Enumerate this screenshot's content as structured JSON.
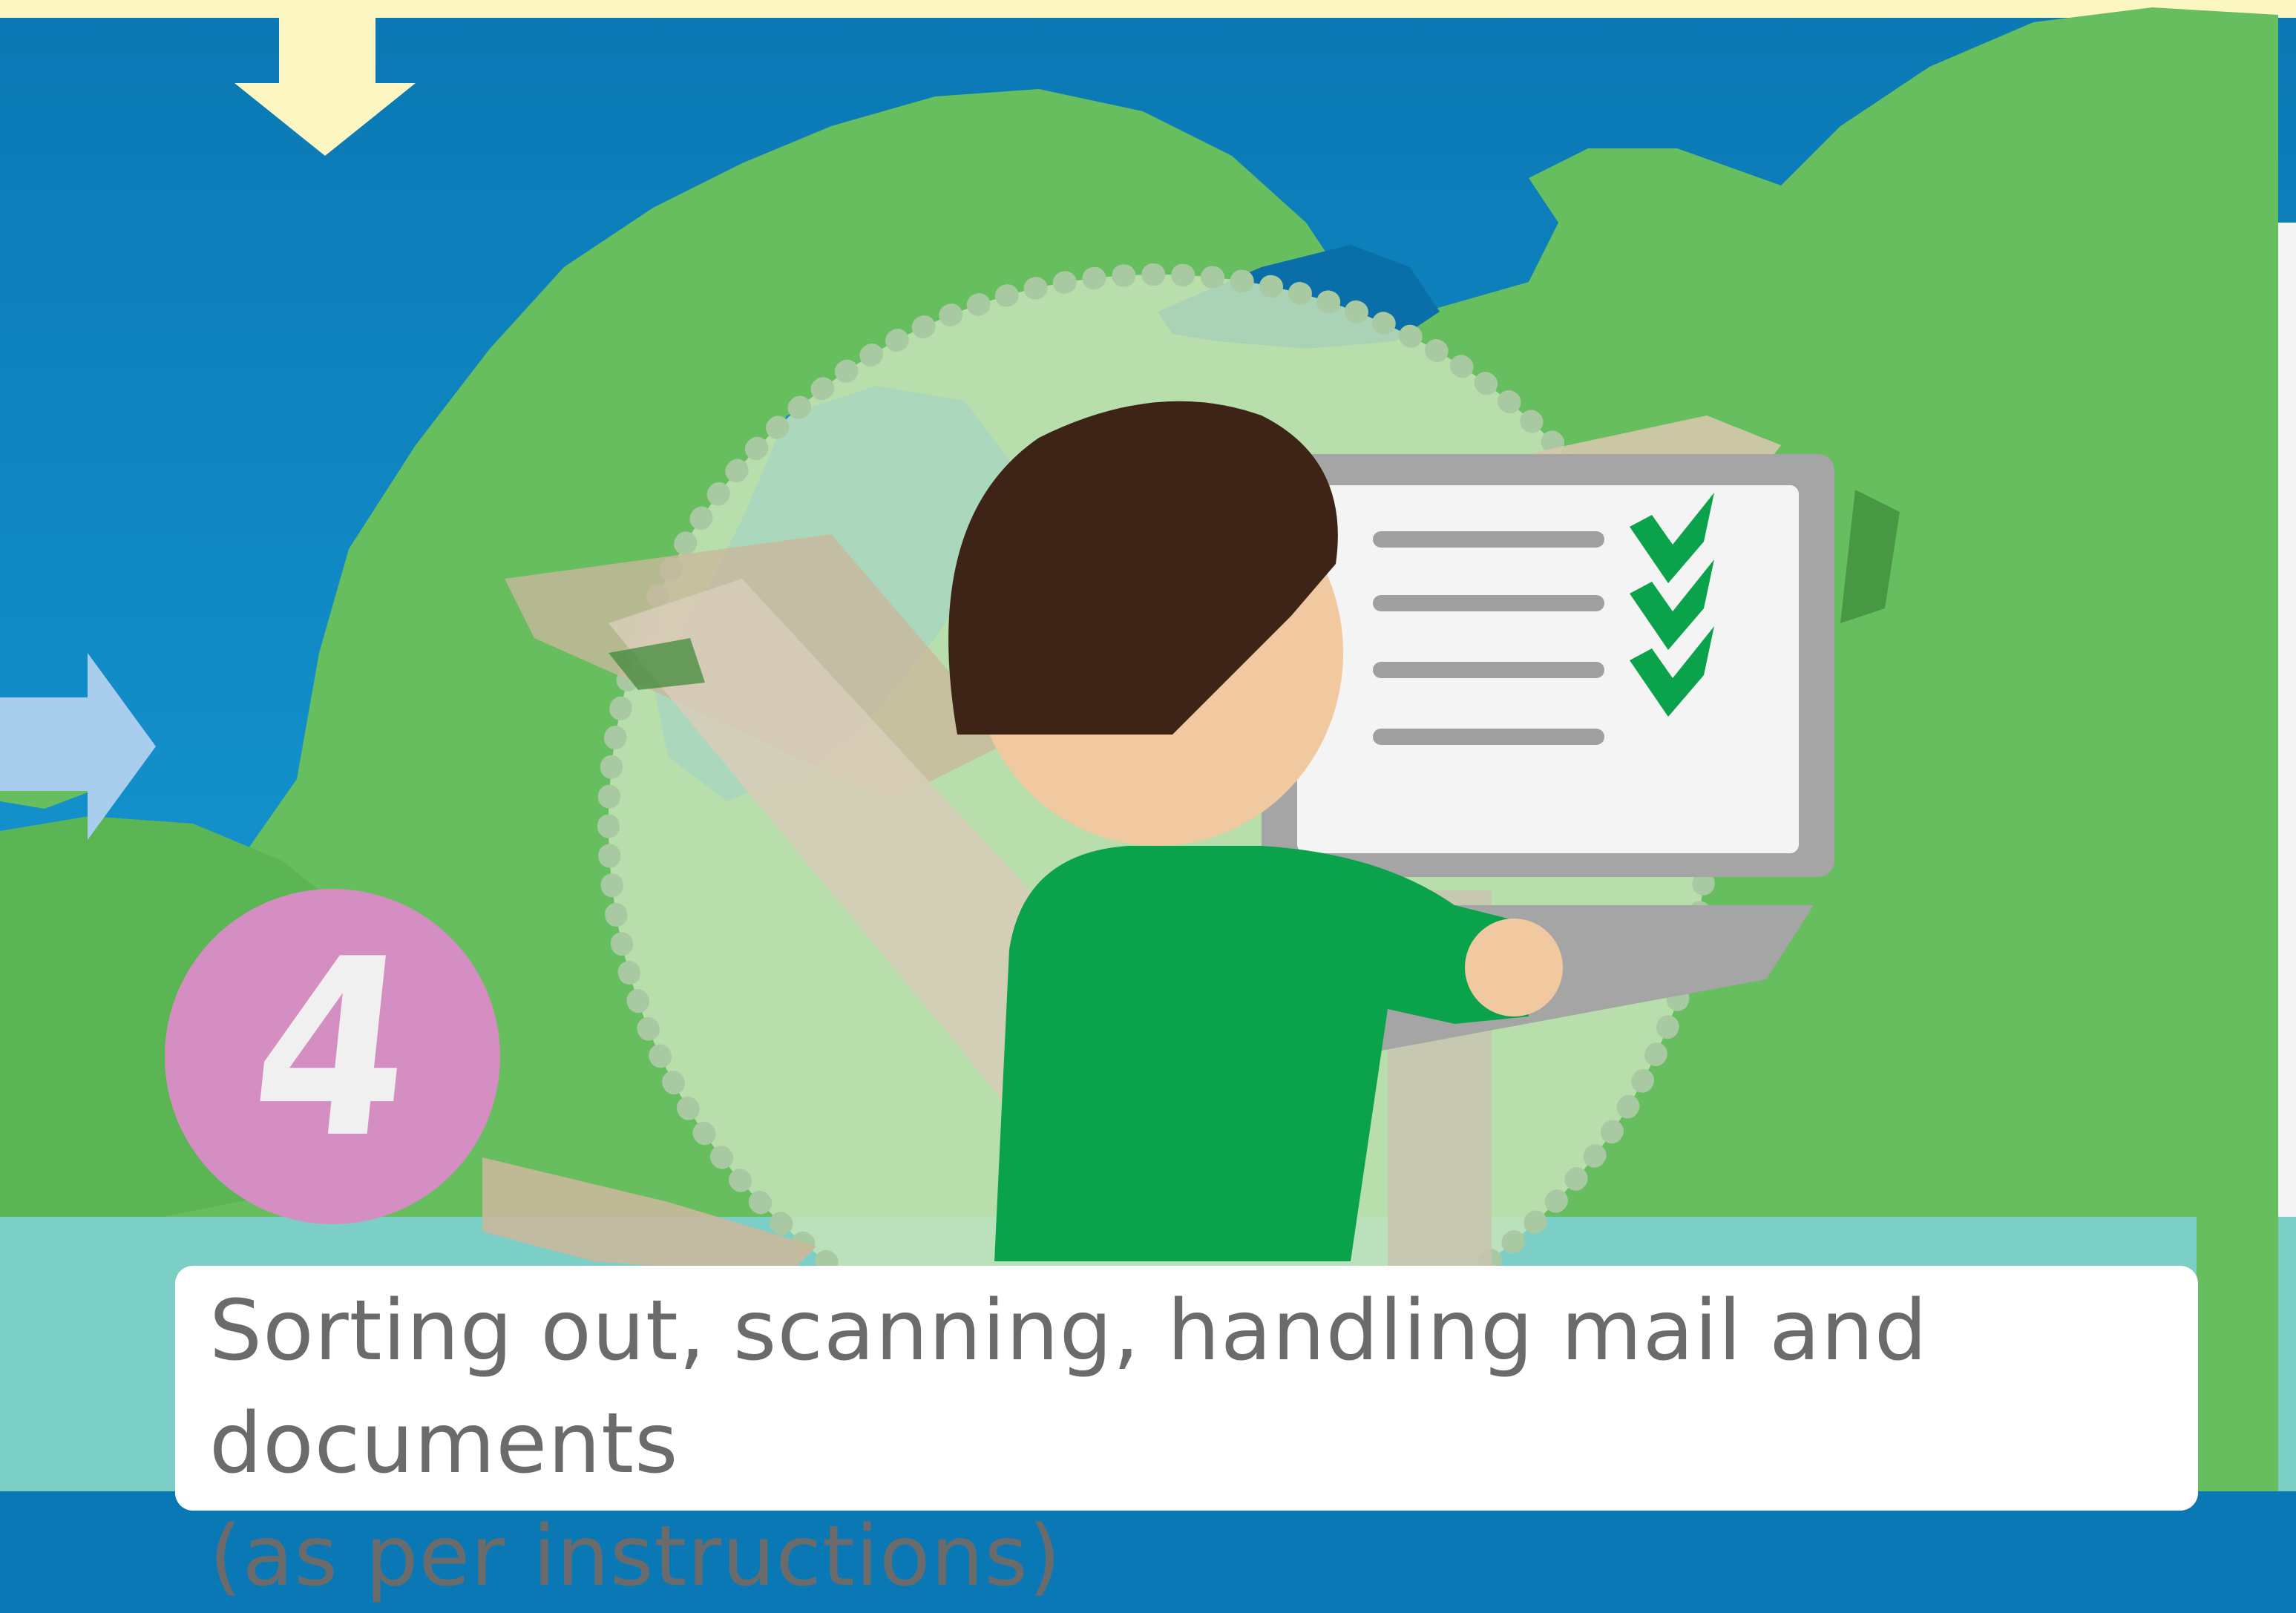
{
  "step": {
    "number": "4"
  },
  "caption": {
    "line1": "Sorting out, scanning, handling mail and documents",
    "line2": "(as per instructions)"
  },
  "checklist": {
    "items": 4,
    "checked": 3
  },
  "colors": {
    "sea": "#0a78b4",
    "land": "#66be5e",
    "highlight_circle": "#c6e4b8",
    "step_badge": "#d48ec1",
    "shirt": "#0aa24a",
    "hair": "#3d2416",
    "skin": "#f1c9a0",
    "laptop": "#a5a5a5",
    "check": "#0aa24a",
    "arrow_down": "#fbf6c2",
    "arrow_right": "#a9ceed"
  }
}
